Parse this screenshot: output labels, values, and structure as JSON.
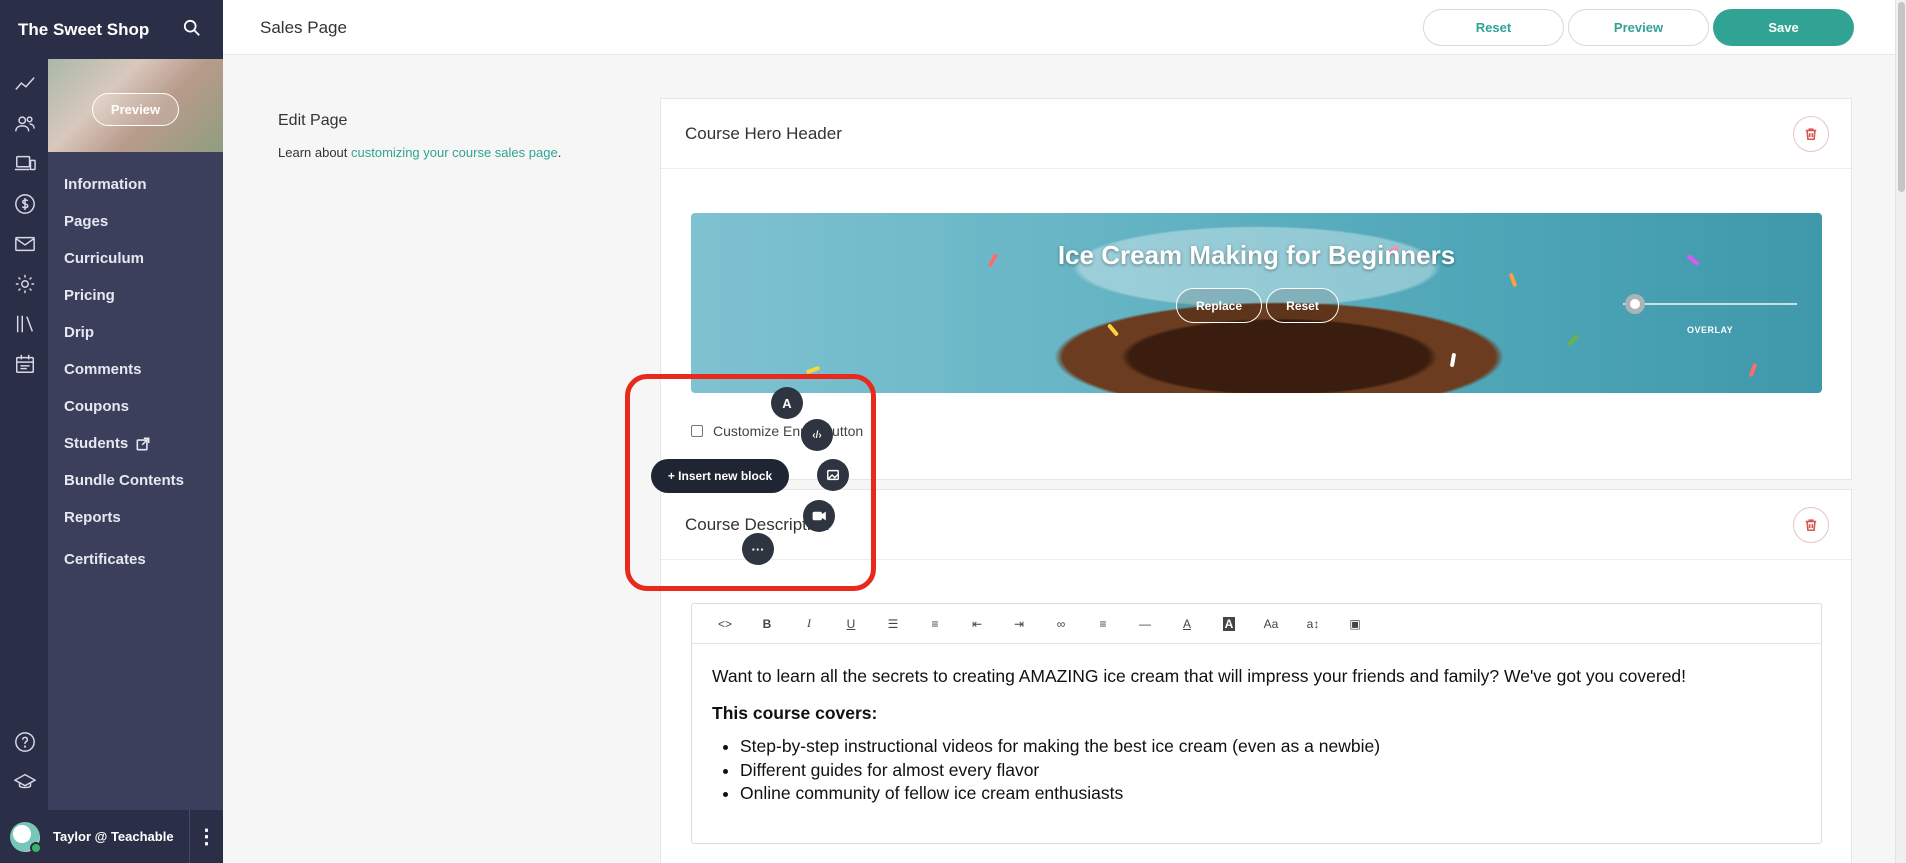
{
  "brand": {
    "title": "The Sweet Shop"
  },
  "rail_icons": [
    "analytics-icon",
    "users-icon",
    "devices-icon",
    "dollar-icon",
    "mail-icon",
    "settings-icon",
    "library-icon",
    "calendar-icon",
    "help-icon",
    "graduation-cap-icon"
  ],
  "course_nav": {
    "thumbnail_preview": "Preview",
    "items": [
      "Information",
      "Pages",
      "Curriculum",
      "Pricing",
      "Drip",
      "Comments",
      "Coupons",
      "Students",
      "Bundle Contents",
      "Reports",
      "Certificates"
    ]
  },
  "user": {
    "name": "Taylor @ Teachable",
    "menu": "⋮"
  },
  "header": {
    "title": "Sales Page",
    "reset_label": "Reset",
    "preview_label": "Preview",
    "save_label": "Save"
  },
  "edit_page": {
    "title": "Edit Page",
    "desc_prefix": "Learn about ",
    "desc_link": "customizing your course sales page",
    "desc_suffix": "."
  },
  "hero_card": {
    "title": "Course Hero Header",
    "hero_title": "Ice Cream Making for Beginners",
    "replace_label": "Replace",
    "reset_label": "Reset",
    "overlay_label": "OVERLAY",
    "overlay_level": 0.05,
    "checkbox_label": "Customize Enroll Button",
    "checkbox_checked": false
  },
  "description_card": {
    "title": "Course Description",
    "toolbar": [
      "code-icon",
      "bold-icon",
      "italic-icon",
      "underline-icon",
      "ordered-list-icon",
      "unordered-list-icon",
      "outdent-icon",
      "indent-icon",
      "link-icon",
      "align-icon",
      "horizontal-rule-icon",
      "text-color-icon",
      "highlight-icon",
      "font-size-icon",
      "line-height-icon",
      "image-icon"
    ],
    "body_intro": "Want to learn all the secrets to creating AMAZING ice cream that will impress your friends and family? We've got you covered!",
    "body_heading": "This course covers:",
    "bullets": [
      "Step-by-step instructional videos for making the best ice cream (even as a newbie)",
      "Different guides for almost every flavor",
      "Online community of fellow ice cream enthusiasts"
    ]
  },
  "insert_menu": {
    "label": "+ Insert new block",
    "text_glyph": "A",
    "code_glyph": "‹/›",
    "more_glyph": "···"
  },
  "colors": {
    "accent": "#31a394",
    "sidebar": "#2b2e47",
    "subnav": "#3b3f5c",
    "highlight": "#e82a1d"
  }
}
